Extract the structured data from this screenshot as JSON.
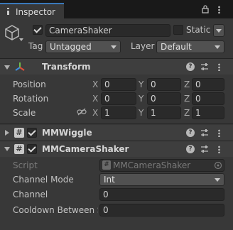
{
  "tab": {
    "label": "Inspector"
  },
  "gameobject": {
    "name": "CameraShaker",
    "static_label": "Static",
    "tag_label": "Tag",
    "tag_value": "Untagged",
    "layer_label": "Layer",
    "layer_value": "Default"
  },
  "transform": {
    "title": "Transform",
    "rows": [
      {
        "label": "Position",
        "x": "0",
        "y": "0",
        "z": "0"
      },
      {
        "label": "Rotation",
        "x": "0",
        "y": "0",
        "z": "0"
      },
      {
        "label": "Scale",
        "x": "1",
        "y": "1",
        "z": "1"
      }
    ],
    "axis_x": "X",
    "axis_y": "Y",
    "axis_z": "Z"
  },
  "mmwiggle": {
    "title": "MMWiggle"
  },
  "mmcamerashaker": {
    "title": "MMCameraShaker",
    "script_label": "Script",
    "script_value": "MMCameraShaker",
    "channel_mode_label": "Channel Mode",
    "channel_mode_value": "Int",
    "channel_label": "Channel",
    "channel_value": "0",
    "cooldown_label": "Cooldown Between S",
    "cooldown_value": "0"
  },
  "colors": {
    "accent": "#3a79bb",
    "background": "#383838",
    "header": "#3e3e3e"
  }
}
